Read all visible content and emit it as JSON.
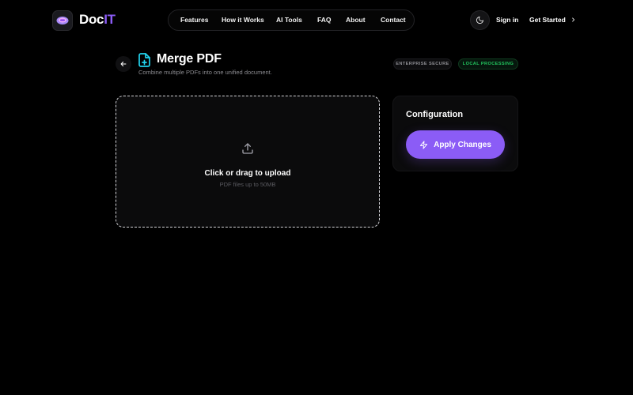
{
  "header": {
    "brand_main": "Doc",
    "brand_accent": "IT",
    "nav": [
      "Features",
      "How it Works",
      "AI Tools",
      "FAQ",
      "About",
      "Contact"
    ],
    "sign_in": "Sign in",
    "get_started": "Get Started"
  },
  "page": {
    "title": "Merge PDF",
    "subtitle": "Combine multiple PDFs into one unified document.",
    "badges": [
      "ENTERPRISE SECURE",
      "LOCAL PROCESSING"
    ]
  },
  "upload": {
    "title": "Click or drag to upload",
    "hint": "PDF files up to 50MB"
  },
  "config": {
    "title": "Configuration",
    "apply_label": "Apply Changes"
  },
  "colors": {
    "accent": "#8b5cf6",
    "success": "#22c55e",
    "title_icon": "#22d3ee"
  },
  "icons": {
    "logo": "docit-logo-icon",
    "theme": "moon-icon",
    "get_started": "chevron-right-icon",
    "back": "arrow-left-icon",
    "title": "file-plus-icon",
    "upload": "upload-icon",
    "apply": "lightning-icon"
  }
}
